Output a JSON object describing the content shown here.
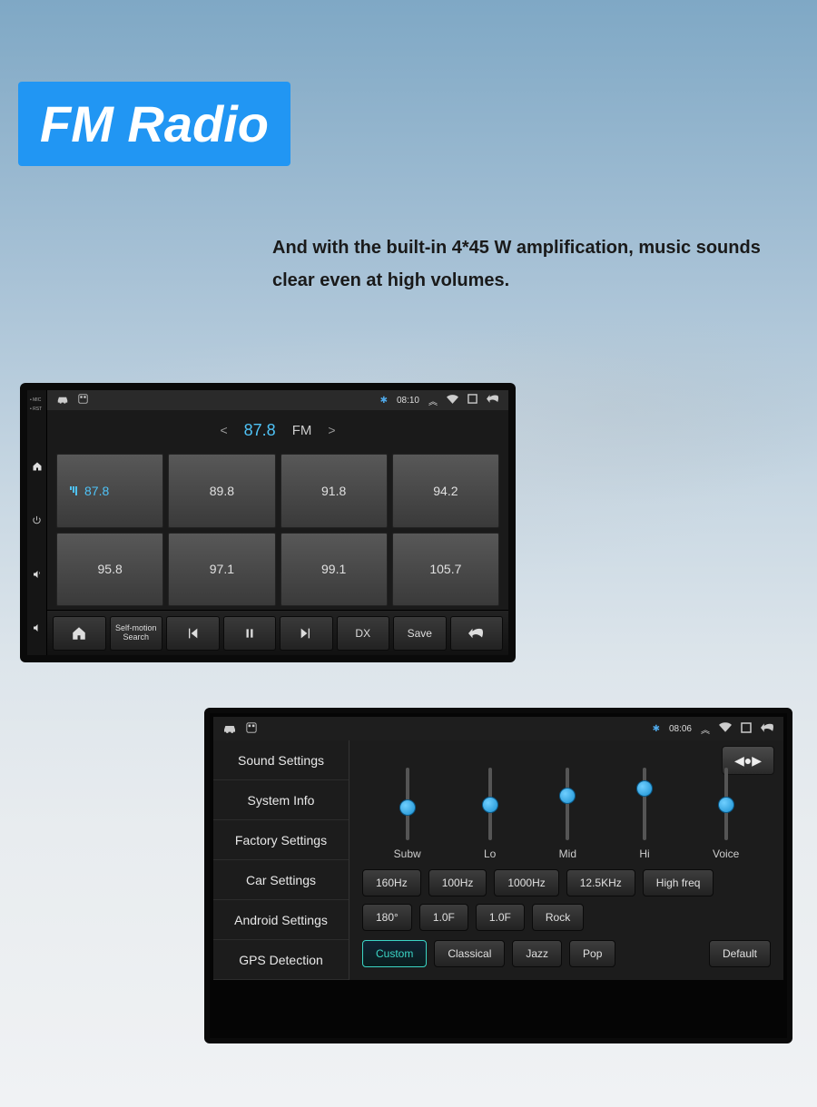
{
  "title": "FM Radio",
  "subtitle": "And with the built-in 4*45 W amplification, music sounds clear even at high volumes.",
  "radio": {
    "statusbar": {
      "time": "08:10"
    },
    "frequency": "87.8",
    "band": "FM",
    "presets": [
      "87.8",
      "89.8",
      "91.8",
      "94.2",
      "95.8",
      "97.1",
      "99.1",
      "105.7"
    ],
    "controls": {
      "search_label": "Self-motion\nSearch",
      "dx_label": "DX",
      "save_label": "Save"
    },
    "side_labels": {
      "mic": "• MIC",
      "rst": "• RST"
    }
  },
  "settings": {
    "statusbar": {
      "time": "08:06"
    },
    "menu": [
      "Sound Settings",
      "System Info",
      "Factory Settings",
      "Car Settings",
      "Android Settings",
      "GPS Detection"
    ],
    "eq": {
      "sliders": [
        {
          "label": "Subw",
          "pos": 0.55
        },
        {
          "label": "Lo",
          "pos": 0.5
        },
        {
          "label": "Mid",
          "pos": 0.35
        },
        {
          "label": "Hi",
          "pos": 0.25
        },
        {
          "label": "Voice",
          "pos": 0.5
        }
      ],
      "freq_row": [
        "160Hz",
        "100Hz",
        "1000Hz",
        "12.5KHz",
        "High freq"
      ],
      "param_row": [
        "180°",
        "1.0F",
        "1.0F",
        "Rock"
      ],
      "preset_row": [
        "Custom",
        "Classical",
        "Jazz",
        "Pop"
      ],
      "active_preset": "Custom",
      "default_label": "Default",
      "balance_label": "◀●▶"
    }
  }
}
